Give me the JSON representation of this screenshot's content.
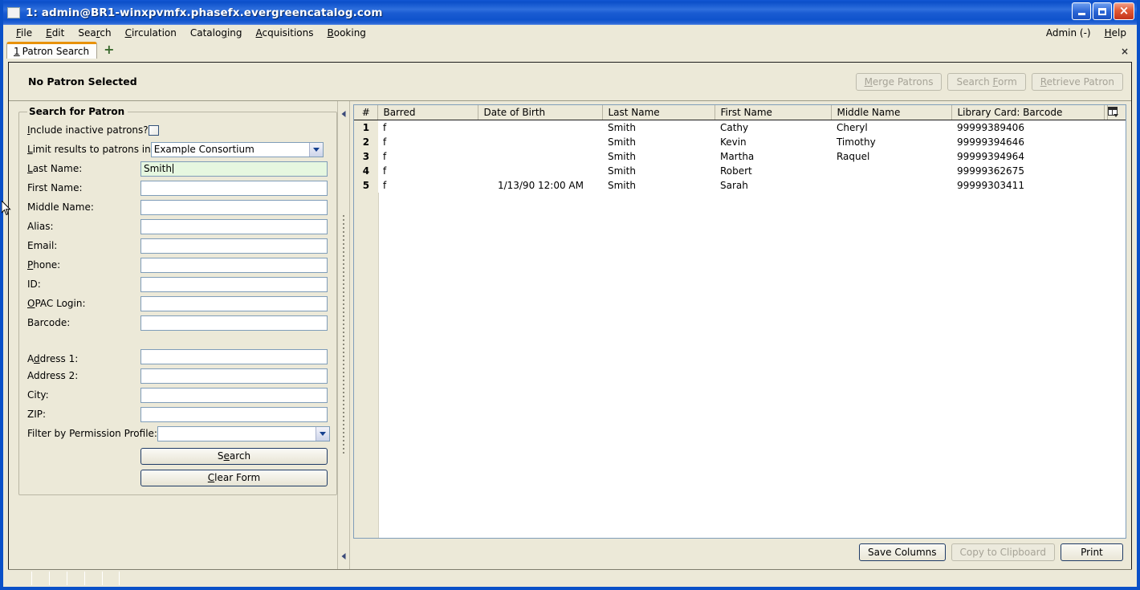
{
  "window": {
    "title": "1: admin@BR1-winxpvmfx.phasefx.evergreencatalog.com",
    "minimize_label": "Minimize",
    "maximize_label": "Maximize",
    "close_label": "Close"
  },
  "menubar": {
    "items": [
      {
        "label": "File",
        "accel": "F"
      },
      {
        "label": "Edit",
        "accel": "E"
      },
      {
        "label": "Search",
        "accel": "r"
      },
      {
        "label": "Circulation",
        "accel": "C"
      },
      {
        "label": "Cataloging",
        "accel": "g"
      },
      {
        "label": "Acquisitions",
        "accel": "A"
      },
      {
        "label": "Booking",
        "accel": "B"
      }
    ],
    "right": [
      {
        "label": "Admin (-)",
        "accel": ""
      },
      {
        "label": "Help",
        "accel": "H"
      }
    ]
  },
  "tabbar": {
    "tabs": [
      {
        "number": "1",
        "label": "Patron Search",
        "active": true
      }
    ],
    "new_tab_label": "+",
    "close_label": "×"
  },
  "patron_header": {
    "title": "No Patron Selected",
    "buttons": [
      {
        "label": "Merge Patrons",
        "accel": "M",
        "enabled": false
      },
      {
        "label": "Search Form",
        "accel": "F",
        "enabled": false
      },
      {
        "label": "Retrieve Patron",
        "accel": "R",
        "enabled": false
      }
    ]
  },
  "search_form": {
    "legend": "Search for Patron",
    "fields": [
      {
        "label": "Include inactive patrons?",
        "accel": "I",
        "type": "checkbox",
        "value": "",
        "checked": false
      },
      {
        "label": "Limit results to patrons in",
        "accel": "L",
        "type": "select",
        "value": "Example Consortium"
      },
      {
        "label": "Last Name:",
        "accel": "L",
        "type": "text",
        "value": "Smith",
        "focused": true
      },
      {
        "label": "First Name:",
        "accel": "",
        "type": "text",
        "value": ""
      },
      {
        "label": "Middle Name:",
        "accel": "",
        "type": "text",
        "value": ""
      },
      {
        "label": "Alias:",
        "accel": "",
        "type": "text",
        "value": ""
      },
      {
        "label": "Email:",
        "accel": "",
        "type": "text",
        "value": ""
      },
      {
        "label": "Phone:",
        "accel": "P",
        "type": "text",
        "value": ""
      },
      {
        "label": "ID:",
        "accel": "",
        "type": "text",
        "value": ""
      },
      {
        "label": "OPAC Login:",
        "accel": "O",
        "type": "text",
        "value": ""
      },
      {
        "label": "Barcode:",
        "accel": "",
        "type": "text",
        "value": ""
      },
      {
        "label": "Address 1:",
        "accel": "d",
        "type": "text",
        "value": "",
        "group_gap": true
      },
      {
        "label": "Address 2:",
        "accel": "",
        "type": "text",
        "value": ""
      },
      {
        "label": "City:",
        "accel": "",
        "type": "text",
        "value": ""
      },
      {
        "label": "ZIP:",
        "accel": "",
        "type": "text",
        "value": ""
      },
      {
        "label": "Filter by Permission Profile:",
        "accel": "",
        "type": "select",
        "value": ""
      }
    ],
    "buttons": [
      {
        "label": "Search",
        "accel": "e"
      },
      {
        "label": "Clear Form",
        "accel": "C"
      }
    ]
  },
  "results": {
    "columns": [
      "#",
      "Barred",
      "Date of Birth",
      "Last Name",
      "First Name",
      "Middle Name",
      "Library Card: Barcode"
    ],
    "column_picker_icon": "column-picker-icon",
    "rows": [
      {
        "num": "1",
        "barred": "f",
        "dob": "",
        "last": "Smith",
        "first": "Cathy",
        "middle": "Cheryl",
        "barcode": "99999389406"
      },
      {
        "num": "2",
        "barred": "f",
        "dob": "",
        "last": "Smith",
        "first": "Kevin",
        "middle": "Timothy",
        "barcode": "99999394646"
      },
      {
        "num": "3",
        "barred": "f",
        "dob": "",
        "last": "Smith",
        "first": "Martha",
        "middle": "Raquel",
        "barcode": "99999394964"
      },
      {
        "num": "4",
        "barred": "f",
        "dob": "",
        "last": "Smith",
        "first": "Robert",
        "middle": "",
        "barcode": "99999362675"
      },
      {
        "num": "5",
        "barred": "f",
        "dob": "1/13/90 12:00 AM",
        "last": "Smith",
        "first": "Sarah",
        "middle": "",
        "barcode": "99999303411"
      }
    ],
    "buttons": [
      {
        "label": "Save Columns",
        "enabled": true
      },
      {
        "label": "Copy to Clipboard",
        "enabled": false
      },
      {
        "label": "Print",
        "enabled": true
      }
    ]
  },
  "statusbar": {
    "cells": [
      "",
      "",
      "",
      "",
      "",
      "",
      ""
    ]
  },
  "colors": {
    "title_blue": "#0a50c8",
    "window_face": "#ece9d8",
    "field_border": "#7f9db9",
    "focus_field_bg": "#e6f7e0",
    "tab_accent": "#e8920a"
  }
}
